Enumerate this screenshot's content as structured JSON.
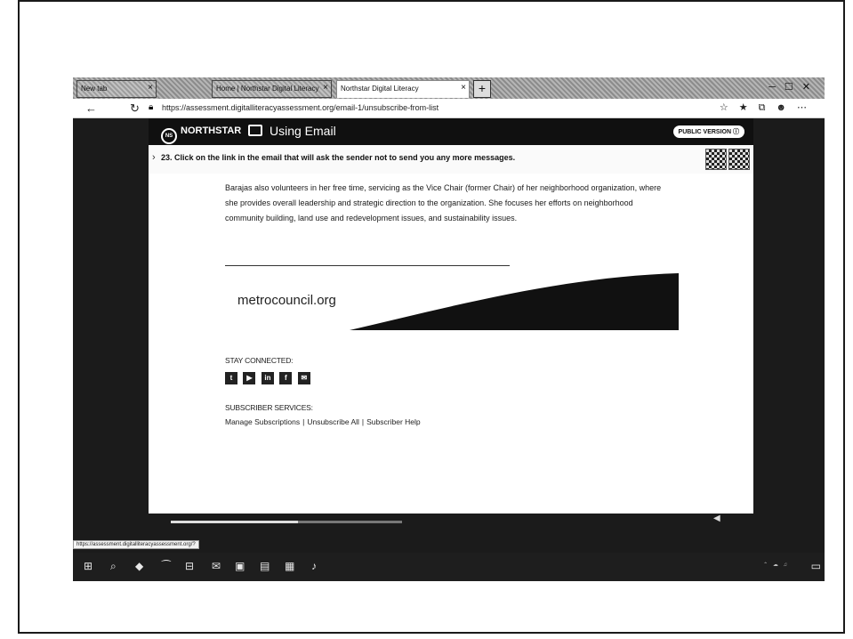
{
  "browser": {
    "tabs": [
      {
        "label": "New tab"
      },
      {
        "label": "Home | Northstar Digital Literacy"
      },
      {
        "label": "Northstar Digital Literacy",
        "active": true
      }
    ],
    "url": "https://assessment.digitalliteracyassessment.org/email-1/unsubscribe-from-list",
    "status_url": "https://assessment.digitalliteracyassessment.org/?"
  },
  "app": {
    "logo_text": "NORTHSTAR",
    "module_title": "Using Email",
    "public_version_label": "PUBLIC VERSION"
  },
  "question": {
    "text": "23. Click on the link in the email that will ask the sender not to send you any more messages."
  },
  "email": {
    "bio": "Barajas also volunteers in her free time, servicing as the Vice Chair (former Chair) of her neighborhood organization, where she provides overall leadership and strategic direction to the organization. She focuses her efforts on neighborhood community building, land use and redevelopment issues, and sustainability issues.",
    "banner_text": "metrocouncil.org",
    "stay_connected_label": "STAY CONNECTED:",
    "social_icons": [
      "twitter-icon",
      "youtube-icon",
      "linkedin-icon",
      "facebook-icon",
      "email-icon"
    ],
    "subscriber_services_label": "SUBSCRIBER SERVICES:",
    "links": {
      "manage": "Manage Subscriptions",
      "unsubscribe": "Unsubscribe All",
      "help": "Subscriber Help"
    },
    "link_separator": "|"
  },
  "player": {
    "progress": 0.55
  },
  "colors": {
    "page_bg": "#1b1b1b",
    "header_bg": "#101010",
    "email_bg": "#ffffff"
  }
}
